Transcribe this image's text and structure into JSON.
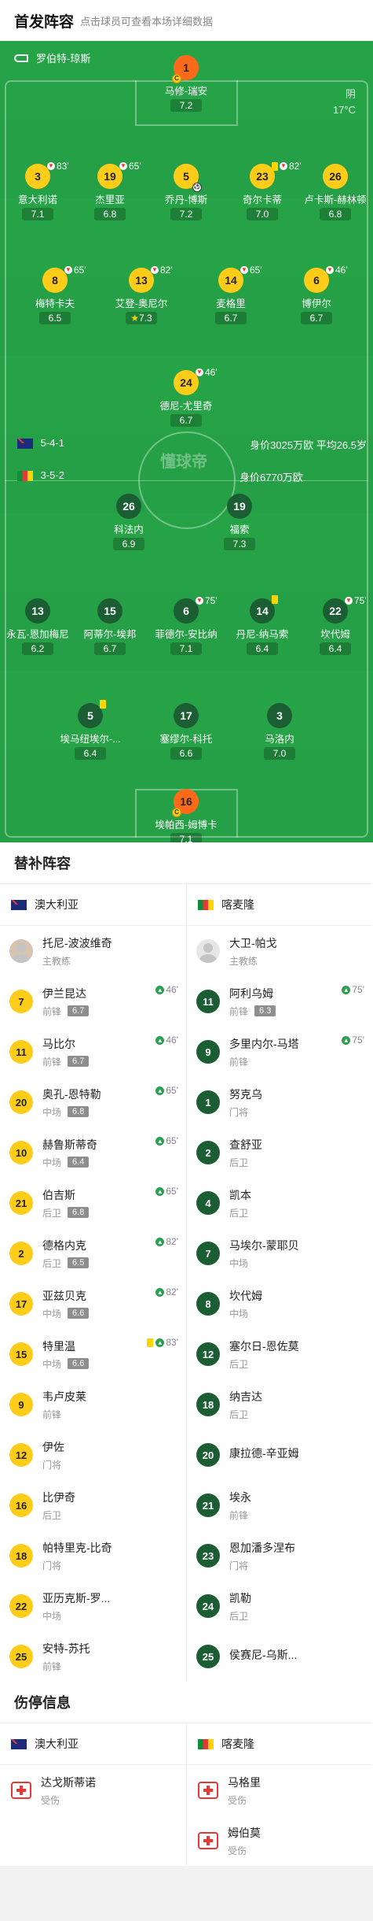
{
  "header": {
    "title": "首发阵容",
    "subtitle": "点击球员可查看本场详细数据"
  },
  "referee": "罗伯特-琼斯",
  "weather": {
    "condition": "阴",
    "temp": "17°C"
  },
  "watermark": "懂球帝",
  "teams": {
    "home": {
      "formation": "5-4-1",
      "value": "身价3025万欧 平均26.5岁"
    },
    "away": {
      "formation": "3-5-2",
      "value": "身价6770万欧"
    }
  },
  "home_lineup": [
    {
      "num": "1",
      "name": "马修-瑞安",
      "rating": "7.2",
      "color": "orange",
      "captain": true
    },
    {
      "num": "3",
      "name": "意大利诺",
      "rating": "7.1",
      "color": "yellow",
      "sub": "83'"
    },
    {
      "num": "19",
      "name": "杰里亚",
      "rating": "6.8",
      "color": "yellow",
      "sub": "65'"
    },
    {
      "num": "5",
      "name": "乔丹-博斯",
      "rating": "7.2",
      "color": "yellow",
      "goal": true
    },
    {
      "num": "23",
      "name": "奇尔卡蒂",
      "rating": "7.0",
      "color": "yellow",
      "card": "yellow",
      "sub": "82'"
    },
    {
      "num": "26",
      "name": "卢卡斯-赫林顿",
      "rating": "6.8",
      "color": "yellow"
    },
    {
      "num": "8",
      "name": "梅特卡夫",
      "rating": "6.5",
      "color": "yellow",
      "sub": "65'"
    },
    {
      "num": "13",
      "name": "艾登-奥尼尔",
      "rating": "7.3",
      "color": "yellow",
      "sub": "82'",
      "star": true
    },
    {
      "num": "14",
      "name": "麦格里",
      "rating": "6.7",
      "color": "yellow",
      "sub": "65'"
    },
    {
      "num": "6",
      "name": "博伊尔",
      "rating": "6.7",
      "color": "yellow",
      "sub": "46'"
    },
    {
      "num": "24",
      "name": "德尼-尤里奇",
      "rating": "6.7",
      "color": "yellow",
      "sub": "46'"
    }
  ],
  "away_lineup": [
    {
      "num": "26",
      "name": "科法内",
      "rating": "6.9"
    },
    {
      "num": "19",
      "name": "福索",
      "rating": "7.3"
    },
    {
      "num": "13",
      "name": "永瓦-恩加梅尼",
      "rating": "6.2"
    },
    {
      "num": "15",
      "name": "阿蒂尔-埃邦",
      "rating": "6.7"
    },
    {
      "num": "6",
      "name": "菲德尔-安比纳",
      "rating": "7.1",
      "sub": "75'"
    },
    {
      "num": "14",
      "name": "丹尼-纳马索",
      "rating": "6.4",
      "card": "yellow"
    },
    {
      "num": "22",
      "name": "坎代姆",
      "rating": "6.4",
      "sub": "75'"
    },
    {
      "num": "5",
      "name": "埃马纽埃尔-...",
      "rating": "6.4",
      "card": "yellow"
    },
    {
      "num": "17",
      "name": "塞缪尔-科托",
      "rating": "6.6"
    },
    {
      "num": "3",
      "name": "马洛内",
      "rating": "7.0"
    },
    {
      "num": "16",
      "name": "埃帕西-姆博卡",
      "rating": "7.1",
      "color": "orange",
      "captain": true
    }
  ],
  "subs_title": "替补阵容",
  "subs": {
    "home_team": "澳大利亚",
    "away_team": "喀麦隆",
    "home_coach": {
      "name": "托尼-波波维奇",
      "role": "主教练"
    },
    "away_coach": {
      "name": "大卫-帕戈",
      "role": "主教练"
    },
    "home": [
      {
        "num": "7",
        "name": "伊兰昆达",
        "pos": "前锋",
        "rating": "6.7",
        "in": "46'"
      },
      {
        "num": "11",
        "name": "马比尔",
        "pos": "前锋",
        "rating": "6.7",
        "in": "46'"
      },
      {
        "num": "20",
        "name": "奥孔-恩特勒",
        "pos": "中场",
        "rating": "6.8",
        "in": "65'"
      },
      {
        "num": "10",
        "name": "赫鲁斯蒂奇",
        "pos": "中场",
        "rating": "6.4",
        "in": "65'"
      },
      {
        "num": "21",
        "name": "伯吉斯",
        "pos": "后卫",
        "rating": "6.8",
        "in": "65'"
      },
      {
        "num": "2",
        "name": "德格内克",
        "pos": "后卫",
        "rating": "6.5",
        "in": "82'"
      },
      {
        "num": "17",
        "name": "亚兹贝克",
        "pos": "中场",
        "rating": "6.6",
        "in": "82'"
      },
      {
        "num": "15",
        "name": "特里温",
        "pos": "中场",
        "rating": "6.6",
        "in": "83'",
        "card": "yellow"
      },
      {
        "num": "9",
        "name": "韦卢皮莱",
        "pos": "前锋"
      },
      {
        "num": "12",
        "name": "伊佐",
        "pos": "门将"
      },
      {
        "num": "16",
        "name": "比伊奇",
        "pos": "后卫"
      },
      {
        "num": "18",
        "name": "帕特里克-比奇",
        "pos": "门将"
      },
      {
        "num": "22",
        "name": "亚历克斯-罗...",
        "pos": "中场"
      },
      {
        "num": "25",
        "name": "安特-苏托",
        "pos": "前锋"
      }
    ],
    "away": [
      {
        "num": "11",
        "name": "阿利乌姆",
        "pos": "前锋",
        "rating": "6.3",
        "in": "75'"
      },
      {
        "num": "9",
        "name": "多里内尔-马塔",
        "pos": "前锋",
        "in": "75'"
      },
      {
        "num": "1",
        "name": "努克乌",
        "pos": "门将"
      },
      {
        "num": "2",
        "name": "查舒亚",
        "pos": "后卫"
      },
      {
        "num": "4",
        "name": "凯本",
        "pos": "后卫"
      },
      {
        "num": "7",
        "name": "马埃尔-蒙耶贝",
        "pos": "中场"
      },
      {
        "num": "8",
        "name": "坎代姆",
        "pos": "中场"
      },
      {
        "num": "12",
        "name": "塞尔日-恩佐莫",
        "pos": "后卫"
      },
      {
        "num": "18",
        "name": "纳吉达",
        "pos": "后卫"
      },
      {
        "num": "20",
        "name": "康拉德-辛亚姆",
        "pos": ""
      },
      {
        "num": "21",
        "name": "埃永",
        "pos": "前锋"
      },
      {
        "num": "23",
        "name": "恩加潘多涅布",
        "pos": "门将"
      },
      {
        "num": "24",
        "name": "凯勒",
        "pos": "后卫"
      },
      {
        "num": "25",
        "name": "侯赛尼-乌斯...",
        "pos": ""
      }
    ]
  },
  "injury_title": "伤停信息",
  "injuries": {
    "home": [
      {
        "name": "达戈斯蒂诺",
        "status": "受伤"
      }
    ],
    "away": [
      {
        "name": "马格里",
        "status": "受伤"
      },
      {
        "name": "姆伯莫",
        "status": "受伤"
      }
    ]
  },
  "colors": {
    "pitch": "#26a046",
    "yellow": "#ffcc1a",
    "orange": "#ff6a1a",
    "away": "#1b5e33"
  }
}
